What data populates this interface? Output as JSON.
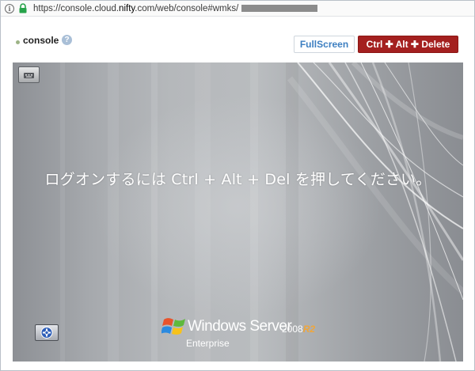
{
  "browser": {
    "url_prefix": "https://console.cloud.",
    "url_host": "nifty",
    "url_rest": ".com/web/console#wmks/"
  },
  "header": {
    "title": "console",
    "help": "?",
    "fullscreen_label": "FullScreen",
    "cad_label": "Ctrl ✚ Alt ✚ Delete"
  },
  "screen": {
    "logon_message": "ログオンするには Ctrl + Alt + Del を押してください。",
    "brand_name": "Windows Server",
    "brand_year": "2008",
    "brand_r2": "R2",
    "brand_edition": "Enterprise"
  },
  "icons": {
    "info": "info-icon",
    "lock": "lock-icon",
    "help": "help-icon",
    "keyboard": "keyboard-icon",
    "accessibility": "accessibility-icon",
    "windows_logo": "windows-logo-icon"
  },
  "colors": {
    "cad_button": "#a4201f",
    "fullscreen_text": "#3d7fc1",
    "lock_green": "#27a34a"
  }
}
